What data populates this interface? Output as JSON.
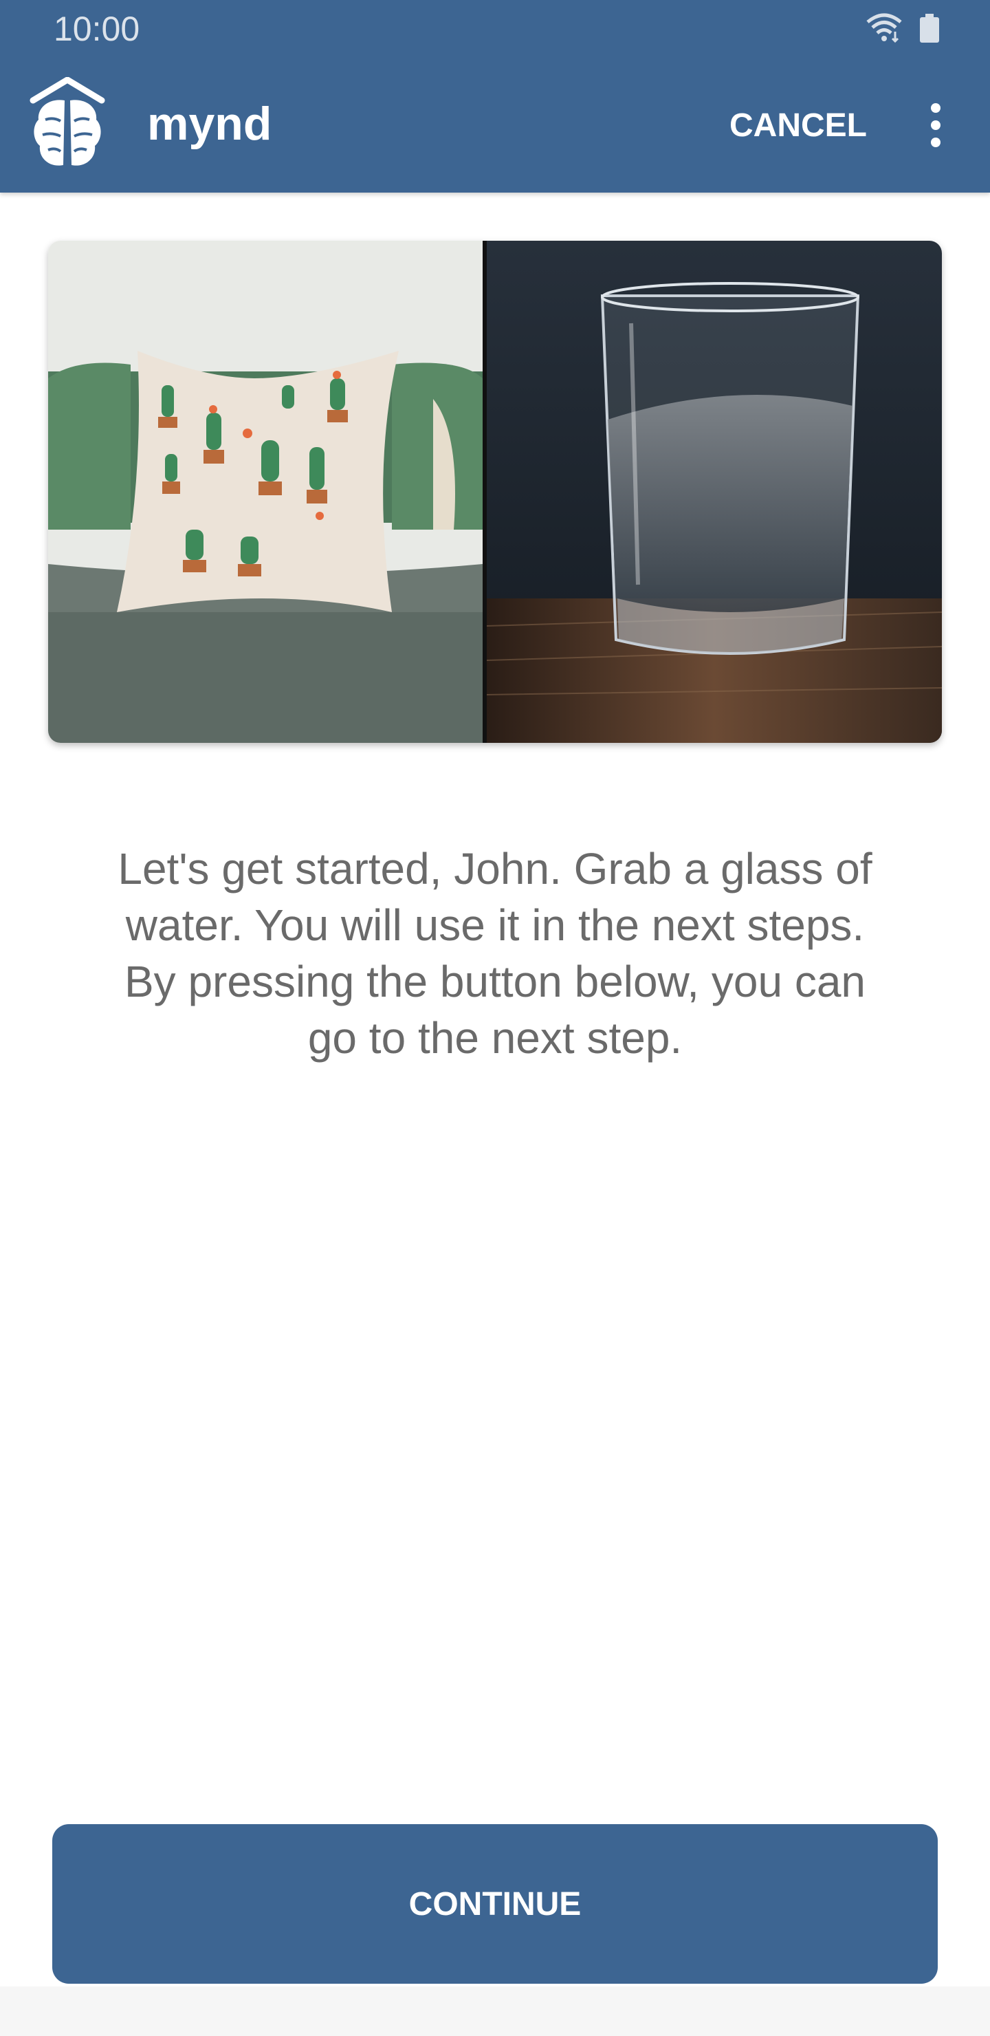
{
  "status_bar": {
    "time": "10:00"
  },
  "app_bar": {
    "title": "mynd",
    "cancel_label": "CANCEL"
  },
  "content": {
    "message": "Let's get started, John.  Grab a glass of water. You will use it in the next steps. By pressing the button below, you can go to the next step."
  },
  "footer": {
    "continue_label": "CONTINUE"
  },
  "colors": {
    "primary": "#3d6592",
    "text_body": "#6a6a6a"
  },
  "icons": [
    "wifi-icon",
    "battery-icon",
    "brain-logo-icon",
    "more-vert-icon"
  ]
}
